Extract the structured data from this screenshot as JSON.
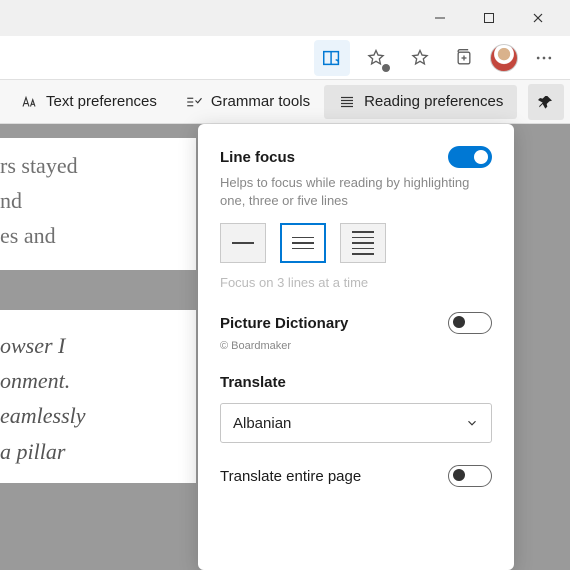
{
  "window": {
    "minimize": "—",
    "maximize": "▢",
    "close": "✕"
  },
  "tabs": {
    "text_pref": "Text preferences",
    "grammar": "Grammar tools",
    "reading": "Reading preferences"
  },
  "bg": {
    "block1": {
      "l1": "rs stayed",
      "l2": "nd",
      "l3": "es and"
    },
    "block2": {
      "l1": "owser I",
      "l2": "onment.",
      "l3": "eamlessly",
      "l4": "a pillar"
    }
  },
  "panel": {
    "lineFocus": {
      "title": "Line focus",
      "help": "Helps to focus while reading by highlighting one, three or five lines",
      "note": "Focus on 3 lines at a time"
    },
    "pictureDict": {
      "title": "Picture Dictionary",
      "copy": "© Boardmaker"
    },
    "translate": {
      "title": "Translate",
      "selected": "Albanian"
    },
    "translatePage": {
      "title": "Translate entire page"
    }
  }
}
